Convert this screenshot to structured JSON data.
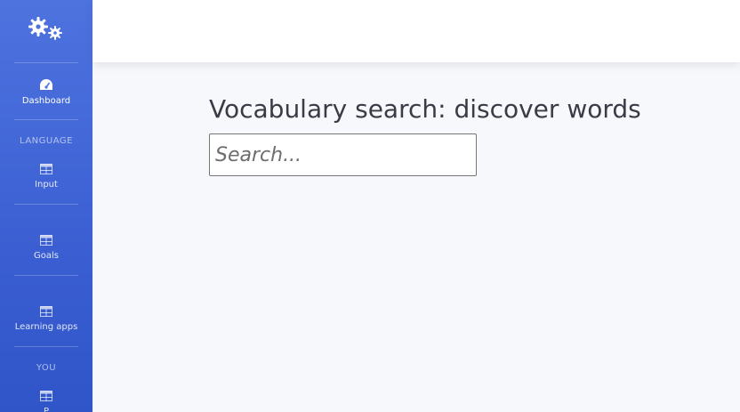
{
  "brand": {
    "icon": "gears-icon"
  },
  "sidebar": {
    "items": [
      {
        "label": "Dashboard",
        "icon": "tachometer-icon"
      },
      {
        "label": "Input",
        "icon": "table-icon"
      },
      {
        "label": "Goals",
        "icon": "table-icon"
      },
      {
        "label": "Learning apps",
        "icon": "table-icon"
      },
      {
        "label": "P",
        "icon": "table-icon"
      }
    ],
    "headings": {
      "language": "LANGUAGE",
      "you": "YOU"
    }
  },
  "main": {
    "title": "Vocabulary search: discover words",
    "search": {
      "placeholder": "Search...",
      "value": ""
    }
  },
  "colors": {
    "sidebar_top": "#4e73df",
    "sidebar_bottom": "#2f55c9",
    "content_bg": "#f7f8fc",
    "text": "#3a3b45"
  }
}
